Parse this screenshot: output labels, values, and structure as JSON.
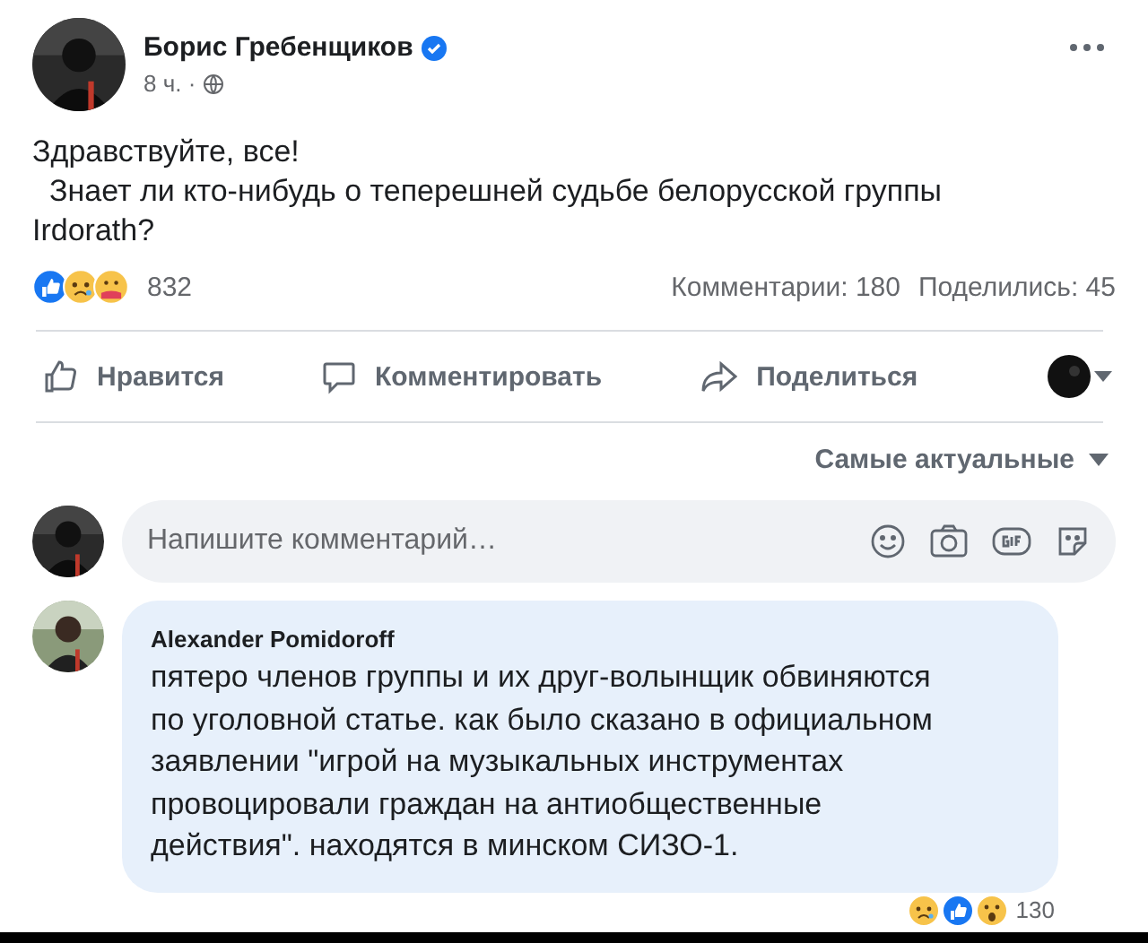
{
  "post": {
    "author": "Борис Гребенщиков",
    "verified": true,
    "time": "8 ч. ·",
    "paragraphs": [
      "Здравствуйте, все!",
      "  Знает ли кто-нибудь о теперешней судьбе белорусской группы Irdorath?"
    ]
  },
  "stats": {
    "reactions": "832",
    "comments": "Комментарии: 180",
    "shares": "Поделились: 45"
  },
  "actions": [
    {
      "kind": "like",
      "label": "Нравится"
    },
    {
      "kind": "comment",
      "label": "Комментировать"
    },
    {
      "kind": "share",
      "label": "Поделиться"
    }
  ],
  "sort": "Самые актуальные",
  "comment_box": {
    "placeholder": "Напишите комментарий…"
  },
  "comments": [
    {
      "author": "Alexander Pomidoroff",
      "text": "пятеро членов группы и их друг-волынщик обвиняются по уголовной статье. как было сказано в официальном заявлении \"игрой на музыкальных инструментах провоцировали граждан на антиобщественные действия\". находятся в минском СИЗО-1.",
      "reactions": "130"
    }
  ]
}
